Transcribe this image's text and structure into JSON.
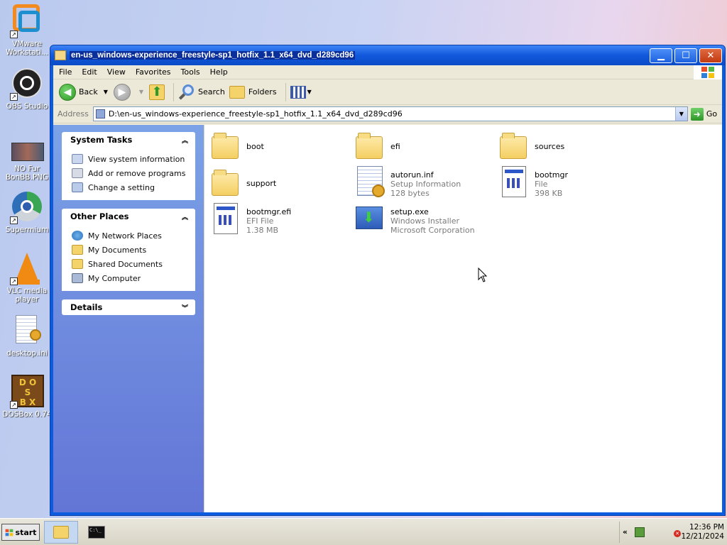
{
  "desktop": {
    "icons": [
      {
        "label": "VMware Workstati...",
        "icon": "vmware-icon"
      },
      {
        "label": "OBS Studio",
        "icon": "obs-icon"
      },
      {
        "label": "NO Fur BonBB.PNG",
        "icon": "image-icon"
      },
      {
        "label": "Supermium",
        "icon": "supermium-icon"
      },
      {
        "label": "VLC media player",
        "icon": "vlc-icon"
      },
      {
        "label": "desktop.ini",
        "icon": "settings-file-icon"
      },
      {
        "label": "DOSBox 0.74",
        "icon": "dosbox-icon"
      }
    ]
  },
  "window": {
    "title": "en-us_windows-experience_freestyle-sp1_hotfix_1.1_x64_dvd_d289cd96",
    "menu": [
      "File",
      "Edit",
      "View",
      "Favorites",
      "Tools",
      "Help"
    ],
    "toolbar": {
      "back": "Back",
      "search": "Search",
      "folders": "Folders"
    },
    "address": {
      "label": "Address",
      "value": "D:\\en-us_windows-experience_freestyle-sp1_hotfix_1.1_x64_dvd_d289cd96",
      "go": "Go"
    },
    "tasks": {
      "system_title": "System Tasks",
      "system_items": [
        "View system information",
        "Add or remove programs",
        "Change a setting"
      ],
      "places_title": "Other Places",
      "places_items": [
        "My Network Places",
        "My Documents",
        "Shared Documents",
        "My Computer"
      ],
      "details_title": "Details"
    },
    "files": [
      {
        "name": "boot",
        "type": "",
        "info": "",
        "icon": "folder-icon"
      },
      {
        "name": "efi",
        "type": "",
        "info": "",
        "icon": "folder-icon"
      },
      {
        "name": "sources",
        "type": "",
        "info": "",
        "icon": "folder-icon"
      },
      {
        "name": "support",
        "type": "",
        "info": "",
        "icon": "folder-icon"
      },
      {
        "name": "autorun.inf",
        "type": "Setup Information",
        "info": "128 bytes",
        "icon": "setup-info-icon"
      },
      {
        "name": "bootmgr",
        "type": "File",
        "info": "398 KB",
        "icon": "file-icon"
      },
      {
        "name": "bootmgr.efi",
        "type": "EFI File",
        "info": "1.38 MB",
        "icon": "file-icon"
      },
      {
        "name": "setup.exe",
        "type": "Windows Installer",
        "info": "Microsoft Corporation",
        "icon": "installer-icon"
      }
    ]
  },
  "taskbar": {
    "start": "start",
    "clock_time": "12:36 PM",
    "clock_date": "12/21/2024",
    "tray_chevron": "«"
  },
  "colors": {
    "title_blue": "#0c5ce0",
    "taskpane_blue": "#6375d6",
    "taskbar": "#d8d5c6"
  }
}
